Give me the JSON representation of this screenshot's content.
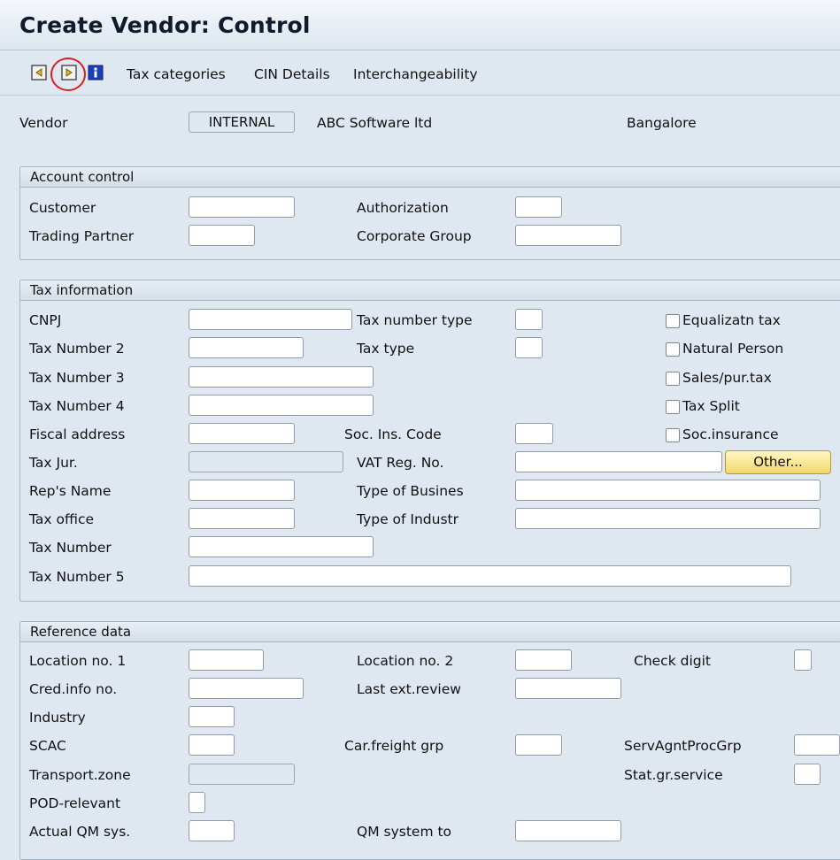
{
  "window": {
    "title": "Create Vendor: Control"
  },
  "toolbar": {
    "prev_screen_icon": "prev-screen-icon",
    "next_screen_icon": "next-screen-icon",
    "info_icon": "info-icon",
    "tax_categories": "Tax categories",
    "cin_details": "CIN Details",
    "interchangeability": "Interchangeability"
  },
  "header": {
    "vendor_label": "Vendor",
    "vendor_value": "INTERNAL",
    "vendor_name": "ABC Software ltd",
    "vendor_city": "Bangalore"
  },
  "account_control": {
    "title": "Account control",
    "customer": "Customer",
    "authorization": "Authorization",
    "trading_partner": "Trading Partner",
    "corporate_group": "Corporate Group"
  },
  "tax_information": {
    "title": "Tax information",
    "cnpj": "CNPJ",
    "tax_number_type": "Tax number type",
    "tax_number_2": "Tax Number 2",
    "tax_type": "Tax type",
    "tax_number_3": "Tax Number 3",
    "tax_number_4": "Tax Number 4",
    "fiscal_address": "Fiscal address",
    "soc_ins_code": "Soc. Ins. Code",
    "tax_jur": "Tax Jur.",
    "vat_reg_no": "VAT Reg. No.",
    "other_button": "Other...",
    "reps_name": "Rep's Name",
    "type_of_business": "Type of Busines",
    "tax_office": "Tax office",
    "type_of_industry": "Type of Industr",
    "tax_number": "Tax Number",
    "tax_number_5": "Tax Number 5",
    "checkboxes": {
      "equalization_tax": "Equalizatn tax",
      "natural_person": "Natural Person",
      "sales_pur_tax": "Sales/pur.tax",
      "tax_split": "Tax Split",
      "soc_insurance": "Soc.insurance"
    }
  },
  "reference_data": {
    "title": "Reference data",
    "location_no_1": "Location no. 1",
    "location_no_2": "Location no. 2",
    "check_digit": "Check digit",
    "cred_info_no": "Cred.info no.",
    "last_ext_review": "Last ext.review",
    "industry": "Industry",
    "scac": "SCAC",
    "car_freight_grp": "Car.freight grp",
    "serv_agnt_proc_grp": "ServAgntProcGrp",
    "transport_zone": "Transport.zone",
    "stat_gr_service": "Stat.gr.service",
    "pod_relevant": "POD-relevant",
    "actual_qm_sys": "Actual QM sys.",
    "qm_system_to": "QM system to"
  }
}
